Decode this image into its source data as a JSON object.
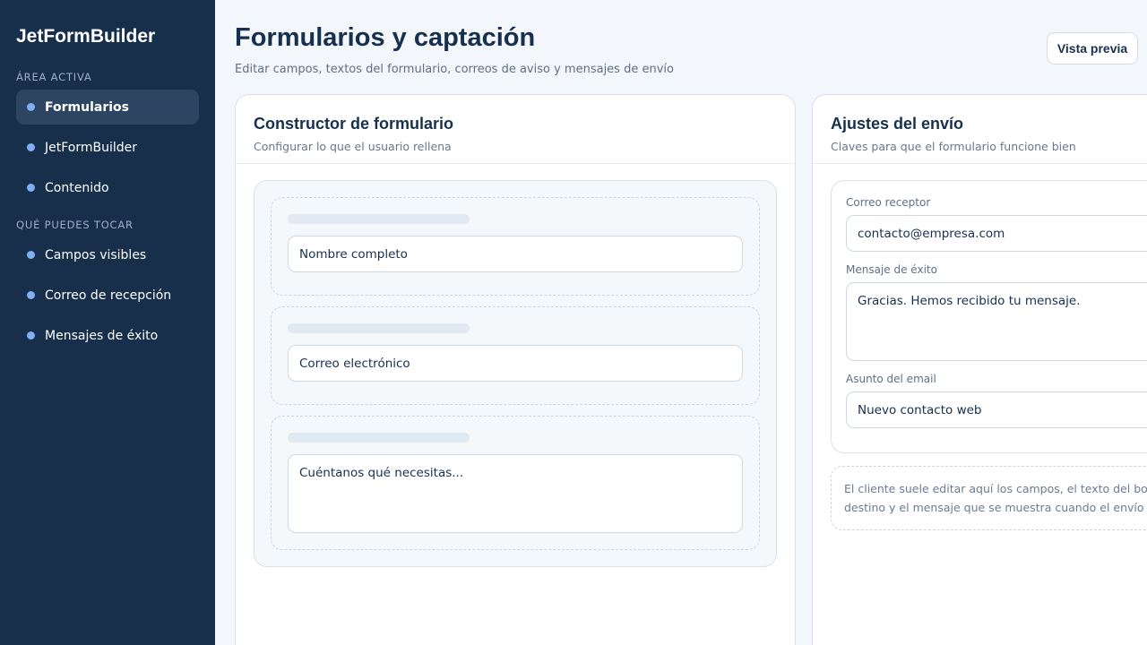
{
  "sidebar": {
    "brand": "JetFormBuilder",
    "section_active": "ÁREA ACTIVA",
    "items_active": [
      {
        "label": "Formularios",
        "active": true
      },
      {
        "label": "JetFormBuilder",
        "active": false
      },
      {
        "label": "Contenido",
        "active": false
      }
    ],
    "section_editable": "QUÉ PUEDES TOCAR",
    "items_editable": [
      {
        "label": "Campos visibles"
      },
      {
        "label": "Correo de recepción"
      },
      {
        "label": "Mensajes de éxito"
      }
    ]
  },
  "header": {
    "title": "Formularios y captación",
    "subtitle": "Editar campos, textos del formulario, correos de aviso y mensajes de envío",
    "preview_button": "Vista previa"
  },
  "builder": {
    "title": "Constructor de formulario",
    "subtitle": "Configurar lo que el usuario rellena",
    "fields": [
      {
        "placeholder": "Nombre completo"
      },
      {
        "placeholder": "Correo electrónico"
      },
      {
        "placeholder": "Cuéntanos qué necesitas..."
      }
    ]
  },
  "settings": {
    "title": "Ajustes del envío",
    "subtitle": "Claves para que el formulario funcione bien",
    "receiver_label": "Correo receptor",
    "receiver_value": "contacto@empresa.com",
    "success_label": "Mensaje de éxito",
    "success_value": "Gracias. Hemos recibido tu mensaje.",
    "subject_label": "Asunto del email",
    "subject_value": "Nuevo contacto web",
    "note_line1": "El cliente suele editar aquí los campos, el texto del botón, e",
    "note_line2": "destino y el mensaje que se muestra cuando el envío se co"
  },
  "colors": {
    "sidebar_bg": "#172f4b",
    "accent_dot": "#7fb0f5",
    "page_bg": "#f3f6fa",
    "text_primary": "#16304d"
  }
}
